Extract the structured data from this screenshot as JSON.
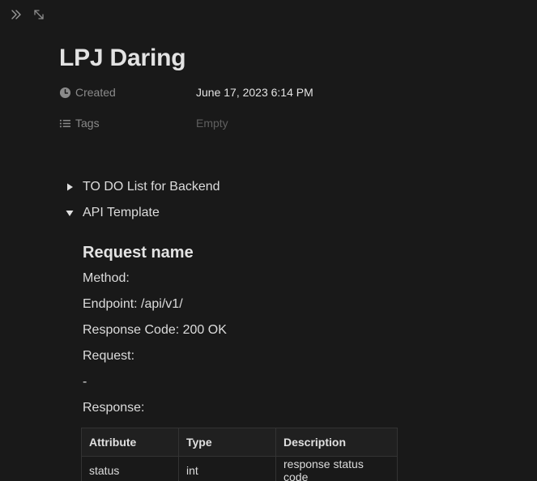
{
  "topbar": {
    "icons": [
      "double-chevron-right-icon",
      "expand-diagonal-icon"
    ]
  },
  "page": {
    "title": "LPJ Daring"
  },
  "properties": {
    "created": {
      "icon": "clock-icon",
      "name": "Created",
      "value": "June 17, 2023 6:14 PM"
    },
    "tags": {
      "icon": "list-icon",
      "name": "Tags",
      "value": "Empty"
    }
  },
  "toggles": {
    "todo": {
      "label": "TO DO List for Backend",
      "state": "collapsed"
    },
    "api": {
      "label": "API Template",
      "state": "expanded"
    }
  },
  "api_template": {
    "heading": "Request name",
    "method": "Method:",
    "endpoint": "Endpoint: /api/v1/",
    "response_code": "Response Code: 200 OK",
    "request": "Request:",
    "request_body": "-",
    "response": "Response:"
  },
  "table": {
    "headers": [
      "Attribute",
      "Type",
      "Description"
    ],
    "rows": [
      [
        "status",
        "int",
        "response status code"
      ]
    ]
  },
  "colors": {
    "background": "#191919",
    "text": "#dcdcdc",
    "muted": "#8a8a8a",
    "placeholder": "#5f5f5f"
  }
}
